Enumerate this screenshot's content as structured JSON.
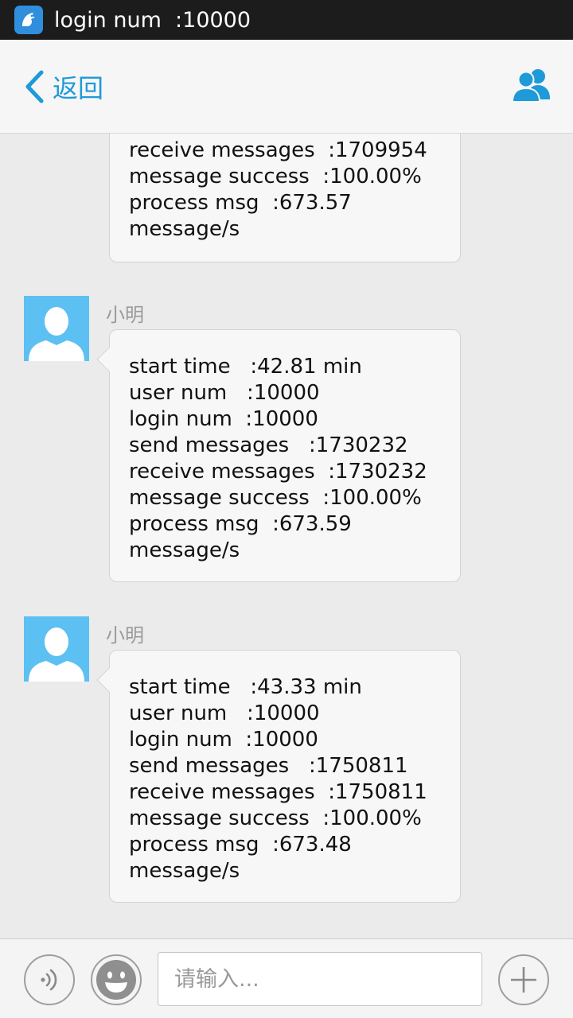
{
  "statusbar": {
    "notification_text": "login num  :10000"
  },
  "header": {
    "back_label": "返回"
  },
  "messages": [
    {
      "lines": [
        "receive messages  :1709954",
        "message success  :100.00%",
        "process msg  :673.57",
        "message/s"
      ]
    },
    {
      "sender": "小明",
      "lines": [
        "start time   :42.81 min",
        "user num   :10000",
        "login num  :10000",
        "send messages   :1730232",
        "receive messages  :1730232",
        "message success  :100.00%",
        "process msg  :673.59",
        "message/s"
      ]
    },
    {
      "sender": "小明",
      "lines": [
        "start time   :43.33 min",
        "user num   :10000",
        "login num  :10000",
        "send messages   :1750811",
        "receive messages  :1750811",
        "message success  :100.00%",
        "process msg  :673.48",
        "message/s"
      ]
    }
  ],
  "inputbar": {
    "placeholder": "请输入..."
  },
  "colors": {
    "accent": "#1e9ad8",
    "avatar_bg": "#5cc0f2",
    "status_bar": "#1c1c1c"
  },
  "icons": {
    "app": "app-bird-icon",
    "back": "chevron-left-icon",
    "contacts": "contacts-icon",
    "voice": "voice-icon",
    "emoji": "smiley-icon",
    "add": "plus-icon"
  }
}
